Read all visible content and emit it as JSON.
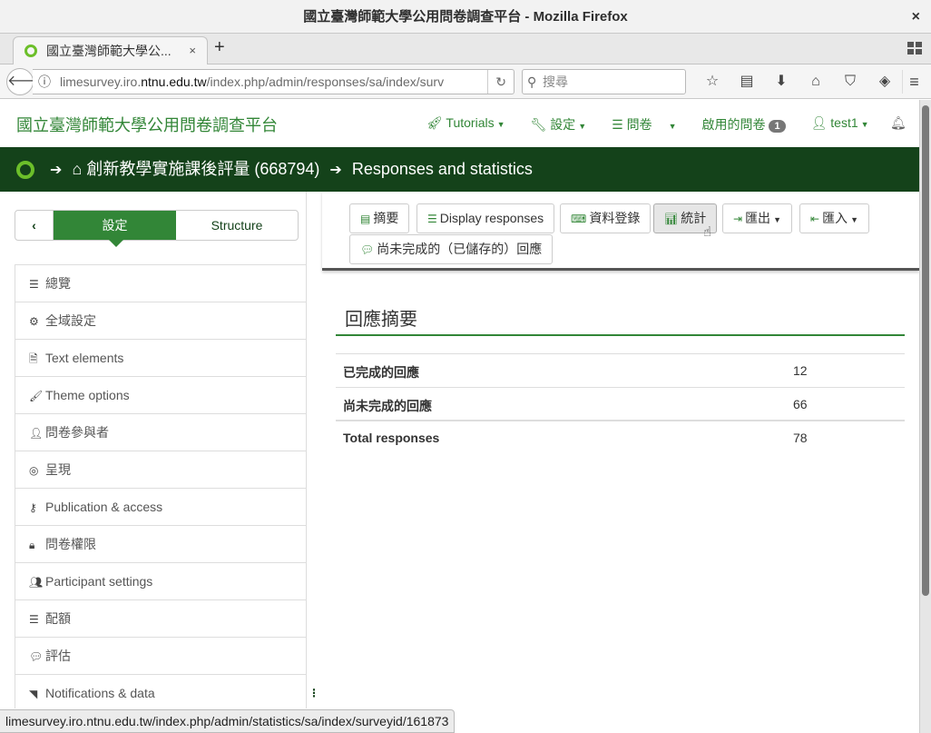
{
  "window": {
    "title": "國立臺灣師範大學公用問卷調查平台 - Mozilla Firefox",
    "close_icon": "×"
  },
  "tab": {
    "title": "國立臺灣師範大學公...",
    "close_icon": "×",
    "new_tab": "+"
  },
  "nav": {
    "url_host_prefix": "limesurvey.iro.",
    "url_host": "ntnu.edu.tw",
    "url_path": "/index.php/admin/responses/sa/index/surv",
    "search_placeholder": "搜尋",
    "icons": [
      "bookmark-star-icon",
      "reading-list-icon",
      "download-icon",
      "home-icon",
      "pocket-icon",
      "share-icon"
    ]
  },
  "app": {
    "brand": "國立臺灣師範大學公用問卷調查平台",
    "menu": {
      "tutorials": "Tutorials",
      "settings": "設定",
      "surveys": "問卷",
      "active_surveys": "啟用的問卷",
      "active_count": "1",
      "user": "test1"
    },
    "breadcrumb": {
      "survey": "創新教學實施課後評量 (668794)",
      "current": "Responses and statistics"
    }
  },
  "sidebar": {
    "toggle": {
      "settings": "設定",
      "structure": "Structure"
    },
    "items": [
      {
        "label": "總覽",
        "icon": "list-icon"
      },
      {
        "label": "全域設定",
        "icon": "cogs-icon"
      },
      {
        "label": "Text elements",
        "icon": "file-text-icon"
      },
      {
        "label": "Theme options",
        "icon": "paint-brush-icon"
      },
      {
        "label": "問卷參與者",
        "icon": "user-icon"
      },
      {
        "label": "呈現",
        "icon": "eye-slash-icon"
      },
      {
        "label": "Publication & access",
        "icon": "key-icon"
      },
      {
        "label": "問卷權限",
        "icon": "lock-icon"
      },
      {
        "label": "Participant settings",
        "icon": "users-icon"
      },
      {
        "label": "配額",
        "icon": "tasks-icon"
      },
      {
        "label": "評估",
        "icon": "comment-icon"
      },
      {
        "label": "Notifications & data",
        "icon": "rss-icon"
      }
    ]
  },
  "toolbar": {
    "summary": "摘要",
    "display_responses": "Display responses",
    "data_entry": "資料登錄",
    "statistics": "統計",
    "export": "匯出",
    "import": "匯入",
    "saved_responses": "尚未完成的（已儲存的）回應"
  },
  "summary": {
    "title": "回應摘要",
    "rows": [
      {
        "label": "已完成的回應",
        "value": "12"
      },
      {
        "label": "尚未完成的回應",
        "value": "66"
      },
      {
        "label": "Total responses",
        "value": "78"
      }
    ]
  },
  "status_url": "limesurvey.iro.ntnu.edu.tw/index.php/admin/statistics/sa/index/surveyid/161873"
}
